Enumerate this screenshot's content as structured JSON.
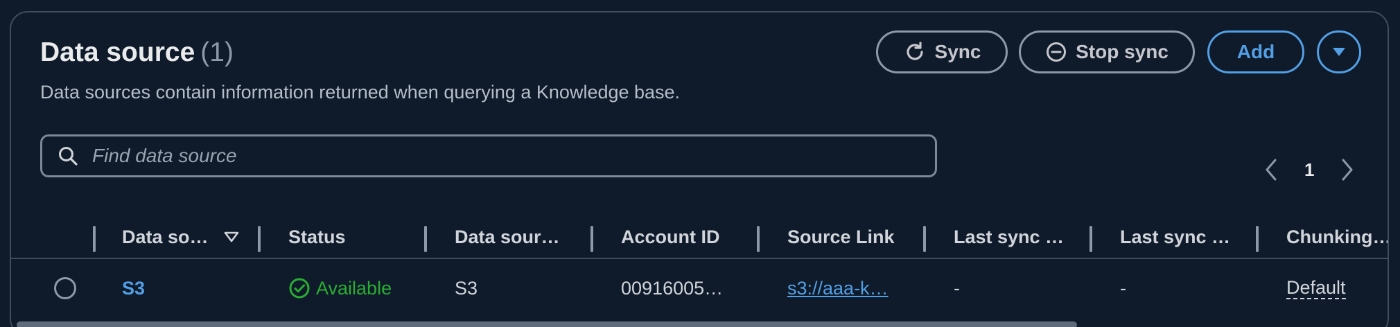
{
  "header": {
    "title": "Data source",
    "count": "(1)",
    "description": "Data sources contain information returned when querying a Knowledge base."
  },
  "actions": {
    "sync_label": "Sync",
    "stop_sync_label": "Stop sync",
    "add_label": "Add"
  },
  "search": {
    "placeholder": "Find data source"
  },
  "pagination": {
    "current_page": "1"
  },
  "table": {
    "columns": [
      "Data so…",
      "Status",
      "Data sour…",
      "Account ID",
      "Source Link",
      "Last sync …",
      "Last sync …",
      "Chunking…"
    ],
    "rows": [
      {
        "name": "S3",
        "status": "Available",
        "type": "S3",
        "account_id": "00916005…",
        "source_link": "s3://aaa-k…",
        "last_sync_1": "-",
        "last_sync_2": "-",
        "chunking": "Default"
      }
    ]
  },
  "colors": {
    "background": "#0f1b2a",
    "accent": "#539fe5",
    "success": "#29ad32"
  }
}
